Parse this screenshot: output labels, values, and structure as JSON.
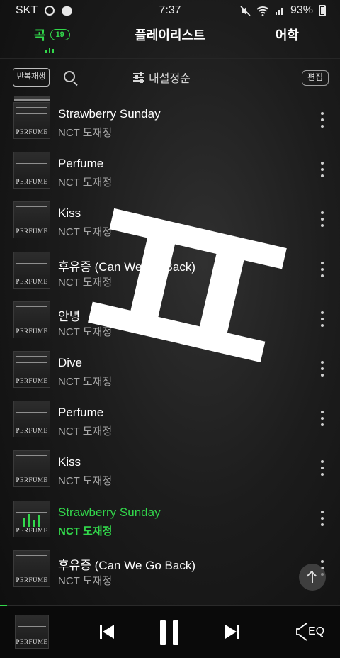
{
  "status_bar": {
    "carrier": "SKT",
    "time": "7:37",
    "battery": "93%"
  },
  "tabs": {
    "songs": {
      "label": "곡",
      "count": "19"
    },
    "playlist": {
      "label": "플레이리스트"
    },
    "learn": {
      "label": "어학"
    }
  },
  "toolbar": {
    "repeat_label": "반복재생",
    "sort_label": "내설정순",
    "edit_label": "편집"
  },
  "songs": [
    {
      "title": "Strawberry Sunday",
      "artist": "NCT 도재정",
      "cover_text": "PERFUME",
      "playing": false
    },
    {
      "title": "Perfume",
      "artist": "NCT 도재정",
      "cover_text": "PERFUME",
      "playing": false
    },
    {
      "title": "Kiss",
      "artist": "NCT 도재정",
      "cover_text": "PERFUME",
      "playing": false
    },
    {
      "title": "후유증 (Can We Go Back)",
      "artist": "NCT 도재정",
      "cover_text": "PERFUME",
      "playing": false
    },
    {
      "title": "안녕",
      "artist": "NCT 도재정",
      "cover_text": "PERFUME",
      "playing": false
    },
    {
      "title": "Dive",
      "artist": "NCT 도재정",
      "cover_text": "PERFUME",
      "playing": false
    },
    {
      "title": "Perfume",
      "artist": "NCT 도재정",
      "cover_text": "PERFUME",
      "playing": false
    },
    {
      "title": "Kiss",
      "artist": "NCT 도재정",
      "cover_text": "PERFUME",
      "playing": false
    },
    {
      "title": "Strawberry Sunday",
      "artist": "NCT 도재정",
      "cover_text": "PERFUME",
      "playing": true
    },
    {
      "title": "후유증 (Can We Go Back)",
      "artist": "NCT 도재정",
      "cover_text": "PERFUME",
      "playing": false
    }
  ],
  "overlay_symbol": "gemini-sign",
  "player": {
    "cover_text": "PERFUME",
    "progress_fraction": 0.02,
    "eq_label": "EQ"
  },
  "colors": {
    "accent": "#32d74b",
    "background": "#1c1c1c",
    "text_secondary": "#a8a8a8"
  }
}
